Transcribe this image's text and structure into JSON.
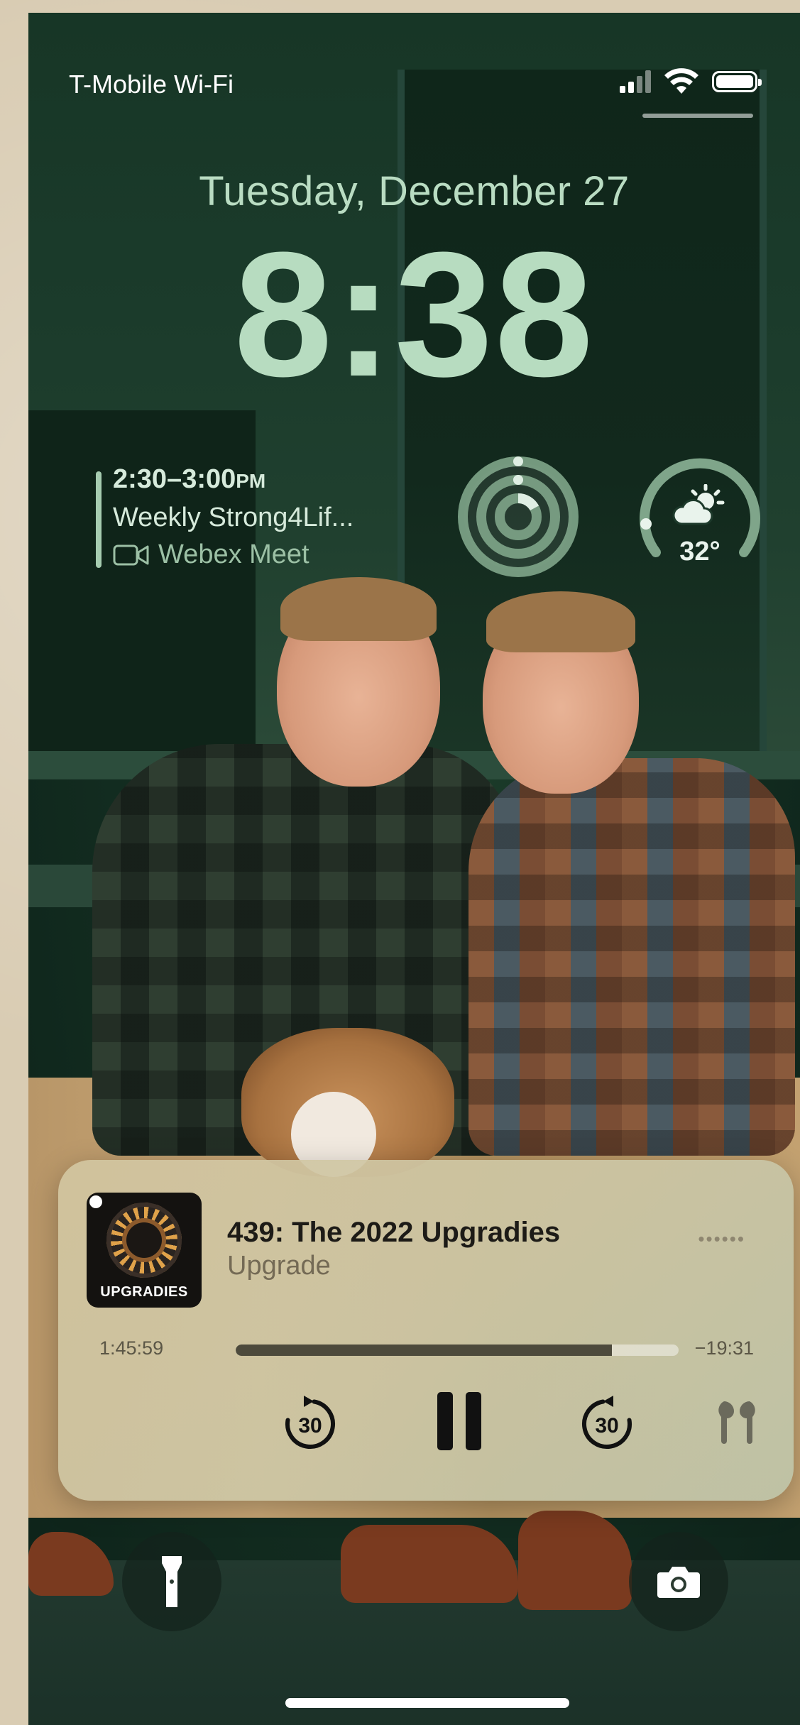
{
  "status_bar": {
    "carrier": "T-Mobile Wi-Fi",
    "signal_icon": "cellular-signal-icon",
    "wifi_icon": "wifi-icon",
    "battery_icon": "battery-icon"
  },
  "lock_screen": {
    "date": "Tuesday, December 27",
    "time": "8:38"
  },
  "widgets": {
    "calendar": {
      "time_range": "2:30–3:00",
      "time_suffix": "PM",
      "title": "Weekly Strong4Lif...",
      "location": "Webex Meet",
      "location_icon": "video-camera-icon"
    },
    "activity_rings_icon": "activity-rings-icon",
    "weather": {
      "temperature": "32°",
      "icon": "partly-cloudy-icon"
    }
  },
  "now_playing": {
    "artwork_label": "UPGRADIES",
    "title": "439: The 2022 Upgradies",
    "subtitle": "Upgrade",
    "elapsed": "1:45:59",
    "remaining": "−19:31",
    "progress_fraction": 0.85,
    "skip_back_label": "30",
    "skip_forward_label": "30",
    "pause_icon": "pause-icon",
    "output_icon": "airpods-icon"
  },
  "quick_actions": {
    "flashlight_icon": "flashlight-icon",
    "camera_icon": "camera-icon"
  },
  "colors": {
    "accent_green": "#b7dcc0",
    "player_bg": "#d2c5a0"
  }
}
